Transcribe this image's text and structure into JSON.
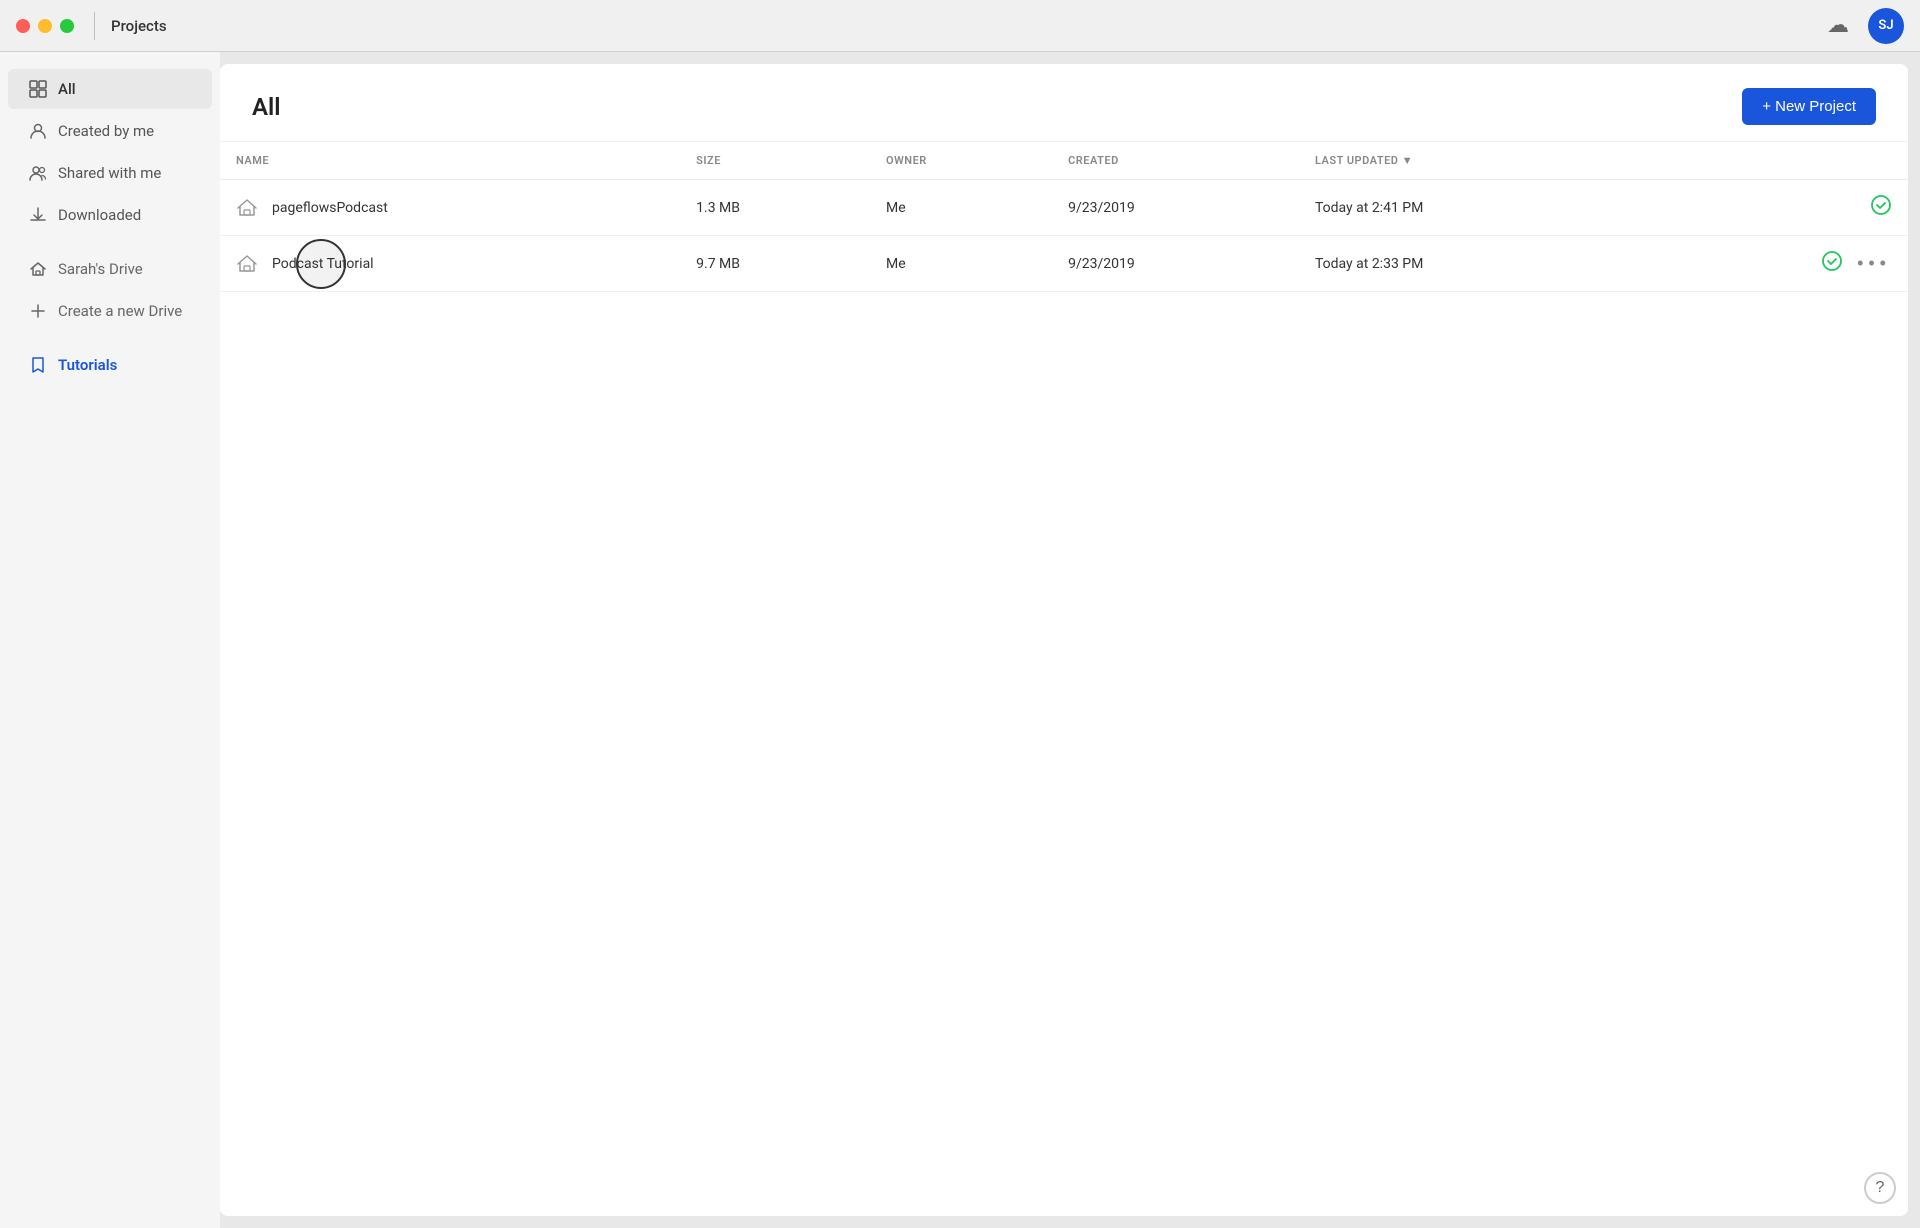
{
  "titlebar": {
    "title": "Projects",
    "avatar_initials": "SJ",
    "avatar_bg": "#1a56db"
  },
  "sidebar": {
    "items": [
      {
        "id": "all",
        "label": "All",
        "icon": "grid",
        "active": true
      },
      {
        "id": "created-by-me",
        "label": "Created by me",
        "icon": "user"
      },
      {
        "id": "shared-with-me",
        "label": "Shared with me",
        "icon": "users"
      },
      {
        "id": "downloaded",
        "label": "Downloaded",
        "icon": "download"
      }
    ],
    "drives": [
      {
        "id": "sarahs-drive",
        "label": "Sarah's Drive",
        "icon": "home"
      }
    ],
    "create_label": "Create a new Drive",
    "tutorials_label": "Tutorials"
  },
  "content": {
    "title": "All",
    "new_project_label": "+ New Project",
    "columns": {
      "name": "NAME",
      "size": "SIZE",
      "owner": "OWNER",
      "created": "CREATED",
      "last_updated": "LAST UPDATED"
    },
    "projects": [
      {
        "name": "pageflowsPodcast",
        "size": "1.3 MB",
        "owner": "Me",
        "created": "9/23/2019",
        "last_updated": "Today at 2:41 PM",
        "status": "synced"
      },
      {
        "name": "Podcast Tutorial",
        "size": "9.7 MB",
        "owner": "Me",
        "created": "9/23/2019",
        "last_updated": "Today at 2:33 PM",
        "status": "synced"
      }
    ]
  },
  "icons": {
    "sort_asc": "▲",
    "sort_desc": "▼",
    "check_circle": "✓",
    "more": "•••",
    "help": "?",
    "cloud": "☁",
    "plus": "+"
  }
}
